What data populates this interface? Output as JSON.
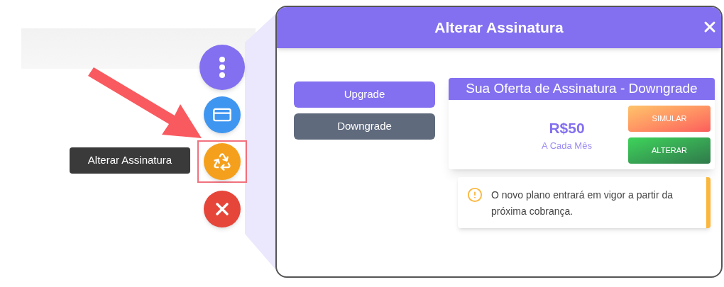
{
  "fab_menu": {
    "tooltip": "Alterar Assinatura",
    "buttons": [
      {
        "kind": "menu",
        "highlighted": false
      },
      {
        "kind": "card",
        "highlighted": false
      },
      {
        "kind": "recycle",
        "highlighted": true
      },
      {
        "kind": "close",
        "highlighted": false
      }
    ]
  },
  "modal": {
    "title": "Alterar Assinatura",
    "tabs": [
      {
        "label": "Upgrade",
        "selected": false
      },
      {
        "label": "Downgrade",
        "selected": true
      }
    ],
    "offer": {
      "title": "Sua Oferta de Assinatura - Downgrade",
      "price": "R$50",
      "period": "A Cada Mês",
      "actions": [
        {
          "kind": "simulate",
          "label": "SIMULAR"
        },
        {
          "kind": "change",
          "label": "ALTERAR"
        }
      ]
    },
    "notice": "O novo plano entrará em vigor a partir da próxima cobrança."
  }
}
